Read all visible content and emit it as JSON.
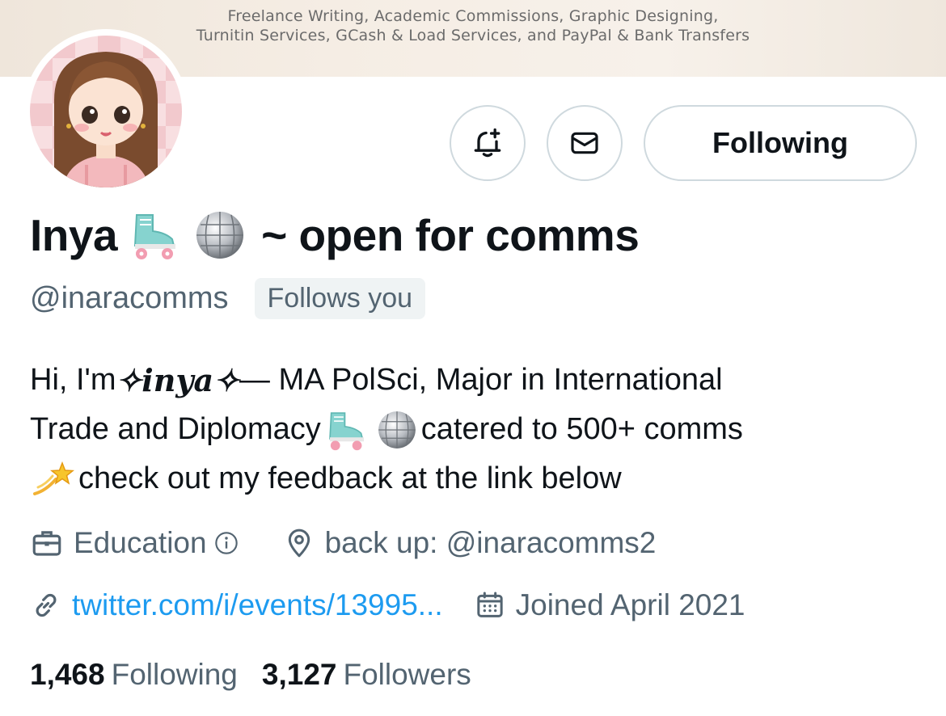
{
  "banner": {
    "line1": "Freelance Writing, Academic Commissions, Graphic Designing,",
    "line2": "Turnitin Services, GCash & Load Services, and PayPal & Bank Transfers"
  },
  "actions": {
    "notify_icon": "bell-plus-icon",
    "message_icon": "envelope-icon",
    "following_label": "Following"
  },
  "profile": {
    "name": "Inya",
    "name_emojis": [
      "roller-skate-icon",
      "mirror-ball-icon"
    ],
    "name_suffix": "~ open for comms",
    "handle": "@inaracomms",
    "follows_you": "Follows you"
  },
  "bio": {
    "line1_prefix": "Hi, I'm ",
    "line1_fancy": "✧inya✧",
    "line1_suffix": " — MA PolSci, Major in International",
    "line2_prefix": "Trade and Diplomacy ",
    "line2_suffix": " catered to 500+ comms",
    "line3_text": " check out my feedback at the link below"
  },
  "meta": {
    "category": "Education",
    "location": "back up: @inaracomms2",
    "link": "twitter.com/i/events/13995...",
    "joined": "Joined April 2021"
  },
  "stats": {
    "following_count": "1,468",
    "following_label": "Following",
    "followers_count": "3,127",
    "followers_label": "Followers"
  },
  "colors": {
    "text": "#0f1419",
    "secondary": "#536471",
    "link": "#1d9bf0",
    "border": "#cfd9de"
  }
}
